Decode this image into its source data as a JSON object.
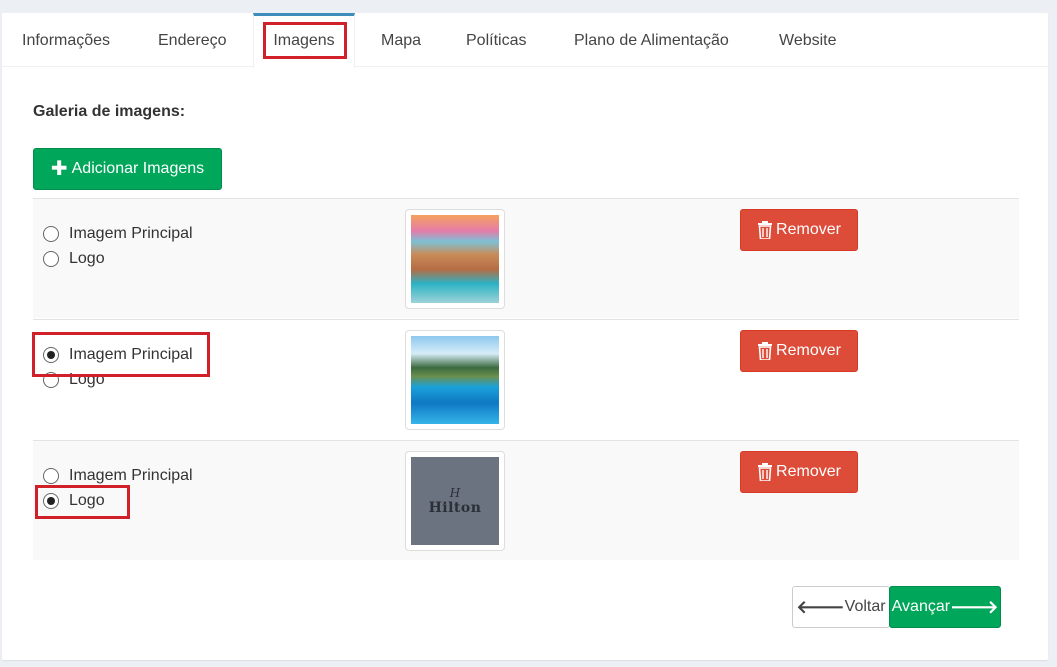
{
  "tabs": [
    {
      "label": "Informações"
    },
    {
      "label": "Endereço"
    },
    {
      "label": "Imagens"
    },
    {
      "label": "Mapa"
    },
    {
      "label": "Políticas"
    },
    {
      "label": "Plano de Alimentação"
    },
    {
      "label": "Website"
    }
  ],
  "active_tab": "Imagens",
  "gallery": {
    "title": "Galeria de imagens:",
    "add_button": "Adicionar Imagens",
    "rows": [
      {
        "main_label": "Imagem Principal",
        "logo_label": "Logo",
        "selected": "none",
        "image": "beach-resort-photo",
        "remove_label": "Remover"
      },
      {
        "main_label": "Imagem Principal",
        "logo_label": "Logo",
        "selected": "main",
        "image": "pool-palm-photo",
        "remove_label": "Remover"
      },
      {
        "main_label": "Imagem Principal",
        "logo_label": "Logo",
        "selected": "logo",
        "image": "hilton-logo",
        "remove_label": "Remover",
        "logo_text": "Hilton",
        "logo_mark": "H"
      }
    ]
  },
  "footer": {
    "back_label": "Voltar",
    "next_label": "Avançar"
  },
  "icons": {
    "add": "plus-icon",
    "remove": "trash-icon",
    "back": "arrow-left-icon",
    "next": "arrow-right-icon"
  },
  "colors": {
    "success": "#00a65a",
    "danger": "#dd4b39",
    "active_tab": "#3c8dbc",
    "highlight": "#d0202a"
  }
}
